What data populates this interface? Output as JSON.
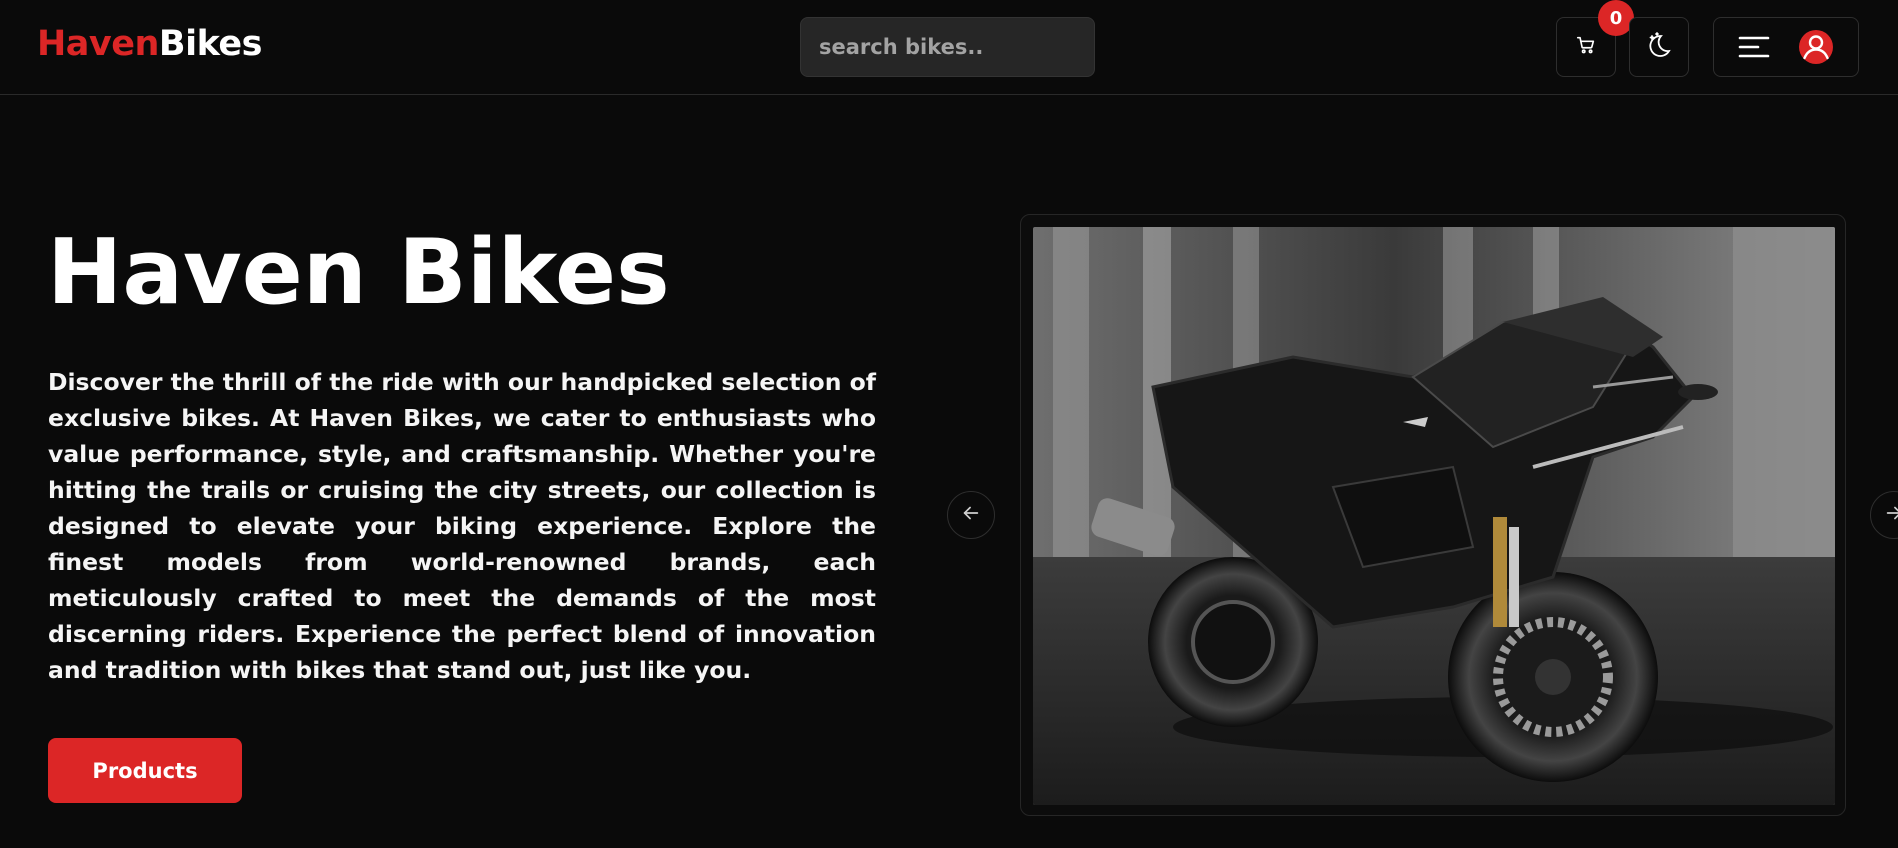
{
  "header": {
    "logo_part1": "Haven",
    "logo_part2": "Bikes",
    "search_placeholder": "search bikes..",
    "cart_count": "0",
    "icons": [
      "cart-icon",
      "theme-toggle-icon",
      "menu-icon",
      "user-avatar-icon"
    ]
  },
  "hero": {
    "title": "Haven Bikes",
    "description": "Discover the thrill of the ride with our handpicked selection of exclusive bikes. At Haven Bikes, we cater to enthusiasts who value performance, style, and craftsmanship. Whether you're hitting the trails or cruising the city streets, our collection is designed to elevate your biking experience. Explore the finest models from world-renowned brands, each meticulously crafted to meet the demands of the most discerning riders. Experience the perfect blend of innovation and tradition with bikes that stand out, just like you.",
    "cta_label": "Products"
  },
  "carousel": {
    "slide_image": "black-sport-motorcycle-photo",
    "prev_icon": "arrow-left-icon",
    "next_icon": "arrow-right-icon"
  },
  "colors": {
    "accent": "#dc2626",
    "background": "#0a0a0a",
    "surface": "#262626"
  }
}
